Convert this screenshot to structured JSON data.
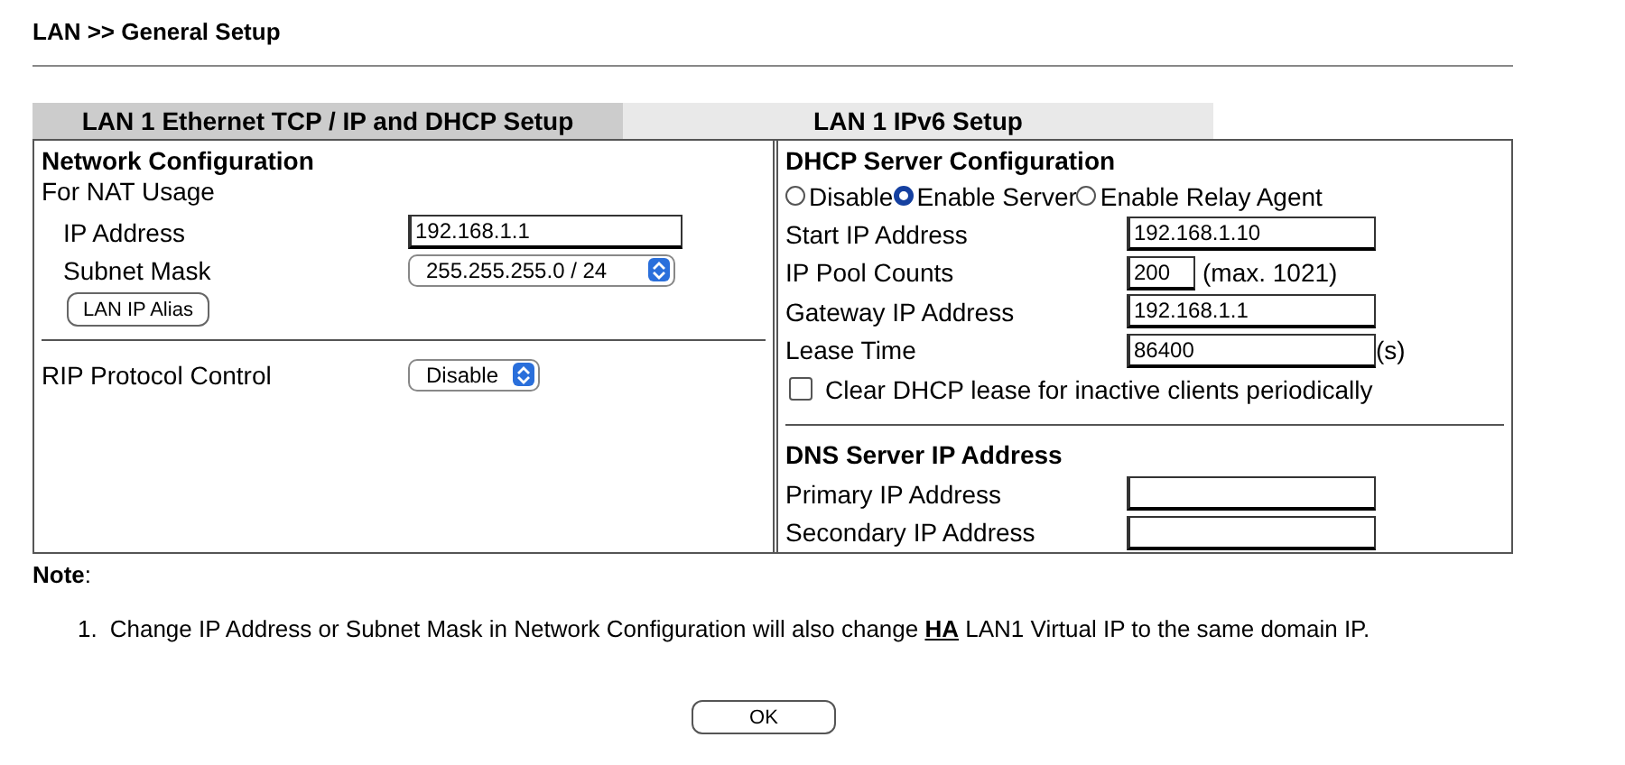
{
  "page_title": "LAN >> General Setup",
  "tabs": [
    {
      "label": "LAN 1 Ethernet TCP / IP and DHCP Setup",
      "selected": true
    },
    {
      "label": "LAN 1 IPv6 Setup",
      "selected": false
    }
  ],
  "network": {
    "heading": "Network Configuration",
    "subheading": "For NAT Usage",
    "fields": [
      {
        "kind": "input",
        "label": "IP Address",
        "value": "192.168.1.1"
      },
      {
        "kind": "select",
        "label": "Subnet Mask",
        "value": "255.255.255.0 / 24"
      }
    ],
    "alias_button": "LAN IP Alias",
    "rip": {
      "label": "RIP Protocol Control",
      "value": "Disable"
    }
  },
  "dhcp": {
    "heading": "DHCP Server Configuration",
    "modes": [
      {
        "label": "Disable",
        "selected": false
      },
      {
        "label": "Enable Server",
        "selected": true
      },
      {
        "label": "Enable Relay Agent",
        "selected": false
      }
    ],
    "fields": [
      {
        "kind": "input",
        "label": "Start IP Address",
        "value": "192.168.1.10"
      },
      {
        "kind": "count",
        "label": "IP Pool Counts",
        "value": "200",
        "note": "(max. 1021)"
      },
      {
        "kind": "input",
        "label": "Gateway IP Address",
        "value": "192.168.1.1"
      },
      {
        "kind": "input",
        "label": "Lease Time",
        "value": "86400",
        "suffix": "(s)"
      }
    ],
    "clear_lease": {
      "label": "Clear DHCP lease for inactive clients periodically",
      "checked": false
    }
  },
  "dns": {
    "heading": "DNS Server IP Address",
    "fields": [
      {
        "label": "Primary IP Address"
      },
      {
        "label": "Secondary IP Address"
      }
    ]
  },
  "note": {
    "title": "**Note**:",
    "items": [
      {
        "number": "1.",
        "text_before": "Change IP Address or Subnet Mask in Network Configuration will also change ",
        "link": "HA",
        "text_after": " LAN1 Virtual IP to the same domain IP."
      }
    ]
  },
  "ok_button": "OK"
}
